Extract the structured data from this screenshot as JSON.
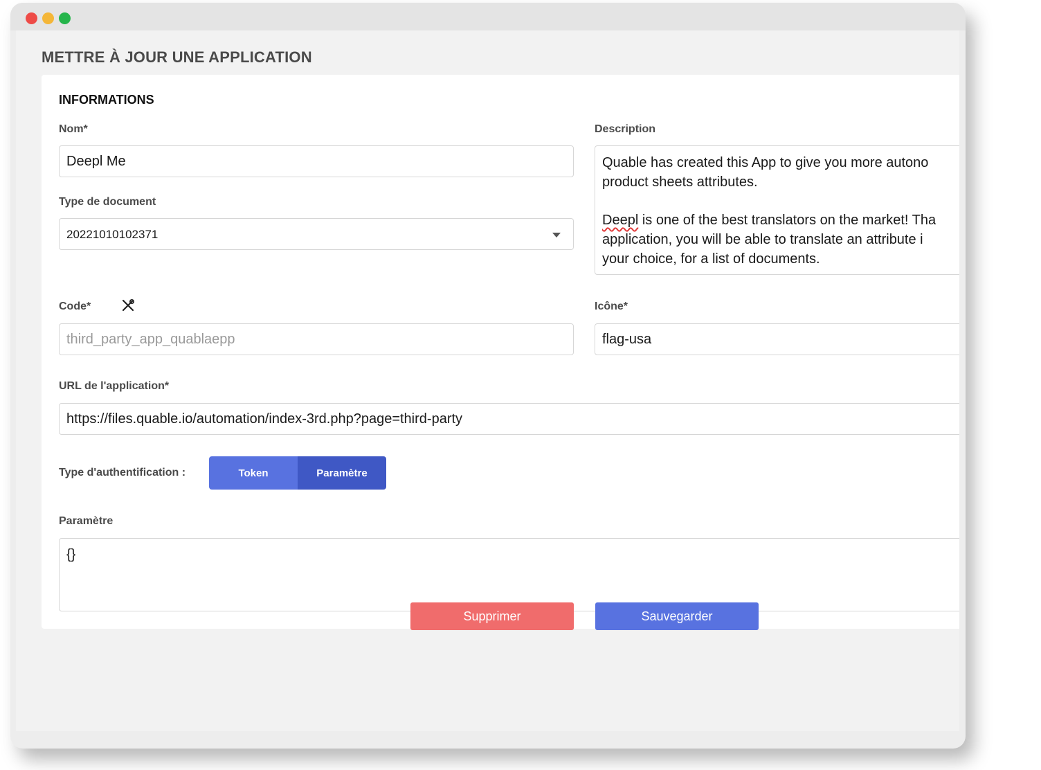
{
  "page": {
    "title": "METTRE À JOUR UNE APPLICATION"
  },
  "section": {
    "title": "INFORMATIONS"
  },
  "fields": {
    "nom": {
      "label": "Nom*",
      "value": "Deepl Me"
    },
    "type_document": {
      "label": "Type de document",
      "value": "20221010102371"
    },
    "description": {
      "label": "Description",
      "line1": "Quable has created this App to give you more autono",
      "line2": "product sheets attributes.",
      "line3_word": "Deepl",
      "line3_rest": " is one of the best translators on the market! Tha",
      "line4": "application, you will be able to translate an attribute i",
      "line5": "your choice, for a list of documents."
    },
    "code": {
      "label": "Code*",
      "value": "third_party_app_quablaepp",
      "icon": "tools-icon"
    },
    "icone": {
      "label": "Icône*",
      "value": "flag-usa"
    },
    "url": {
      "label": "URL de l'application*",
      "value": "https://files.quable.io/automation/index-3rd.php?page=third-party"
    },
    "auth": {
      "label": "Type d'authentification :",
      "options": [
        "Token",
        "Paramètre"
      ],
      "selected": "Paramètre"
    },
    "parametre": {
      "label": "Paramètre",
      "value": "{}"
    }
  },
  "actions": {
    "delete_label": "Supprimer",
    "save_label": "Sauvegarder"
  },
  "colors": {
    "primary": "#5872e0",
    "primary_active": "#3f58c5",
    "danger": "#f06c6c"
  }
}
